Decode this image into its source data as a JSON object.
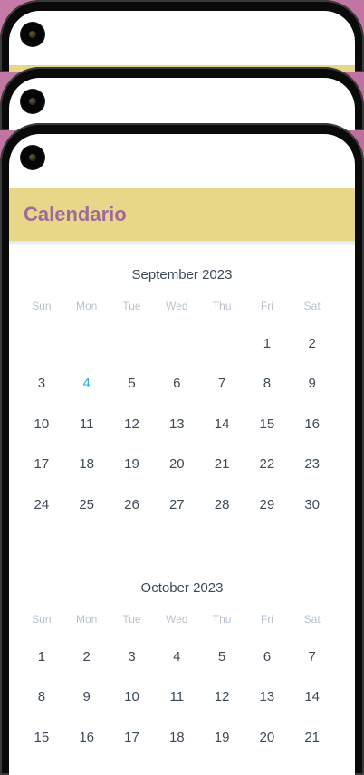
{
  "app": {
    "title": "Calendario"
  },
  "weekdays": [
    "Sun",
    "Mon",
    "Tue",
    "Wed",
    "Thu",
    "Fri",
    "Sat"
  ],
  "months": [
    {
      "title": "September 2023",
      "leading_blanks": 5,
      "days": [
        "1",
        "2",
        "3",
        "4",
        "5",
        "6",
        "7",
        "8",
        "9",
        "10",
        "11",
        "12",
        "13",
        "14",
        "15",
        "16",
        "17",
        "18",
        "19",
        "20",
        "21",
        "22",
        "23",
        "24",
        "25",
        "26",
        "27",
        "28",
        "29",
        "30"
      ],
      "highlighted_day": "4"
    },
    {
      "title": "October 2023",
      "leading_blanks": 0,
      "days": [
        "1",
        "2",
        "3",
        "4",
        "5",
        "6",
        "7",
        "8",
        "9",
        "10",
        "11",
        "12",
        "13",
        "14",
        "15",
        "16",
        "17",
        "18",
        "19",
        "20",
        "21"
      ],
      "highlighted_day": null
    }
  ],
  "colors": {
    "header_bg": "#e8d789",
    "title": "#9e6a9b",
    "today": "#29aede",
    "day_text": "#3c4a5a",
    "weekday_text": "#b8c2cc"
  }
}
